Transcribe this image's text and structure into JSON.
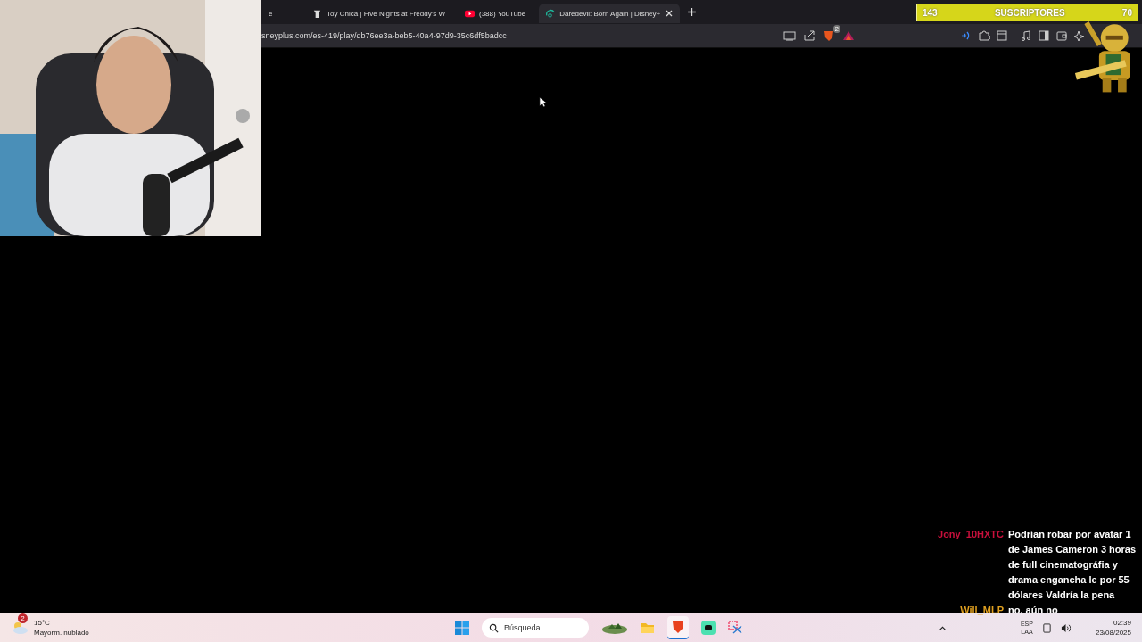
{
  "browser": {
    "tabs": [
      {
        "title": "e",
        "selected": false,
        "kind": "plain"
      },
      {
        "title": "Toy Chica | Five Nights at Freddy's W",
        "selected": false,
        "kind": "figure"
      },
      {
        "title": "(388) YouTube",
        "selected": false,
        "kind": "video"
      },
      {
        "title": "Daredevil: Born Again | Disney+",
        "selected": true,
        "kind": "stream"
      }
    ],
    "address": "sneyplus.com/es-419/play/db76ee3a-beb5-40a4-97d9-35c6df5badcc",
    "shield_badge": "2"
  },
  "subscribers": {
    "current": "143",
    "label": "SUSCRIPTORES",
    "goal": "70"
  },
  "chat": [
    {
      "user": "Jony_10HXTC",
      "color": "#c8103c",
      "message": "Podrían robar por avatar 1 de James Cameron 3 horas de full cinematográfia y drama engancha le por 55 dólares Valdría la pena"
    },
    {
      "user": "Will_MLP",
      "color": "#e0a020",
      "message": "no, aún no"
    }
  ],
  "taskbar": {
    "weather_badge": "2",
    "temperature": "15°C",
    "condition": "Mayorm. nublado",
    "search_placeholder": "Búsqueda",
    "language": "ESP",
    "layout": "LAA",
    "time": "02:39",
    "date": "23/08/2025"
  }
}
